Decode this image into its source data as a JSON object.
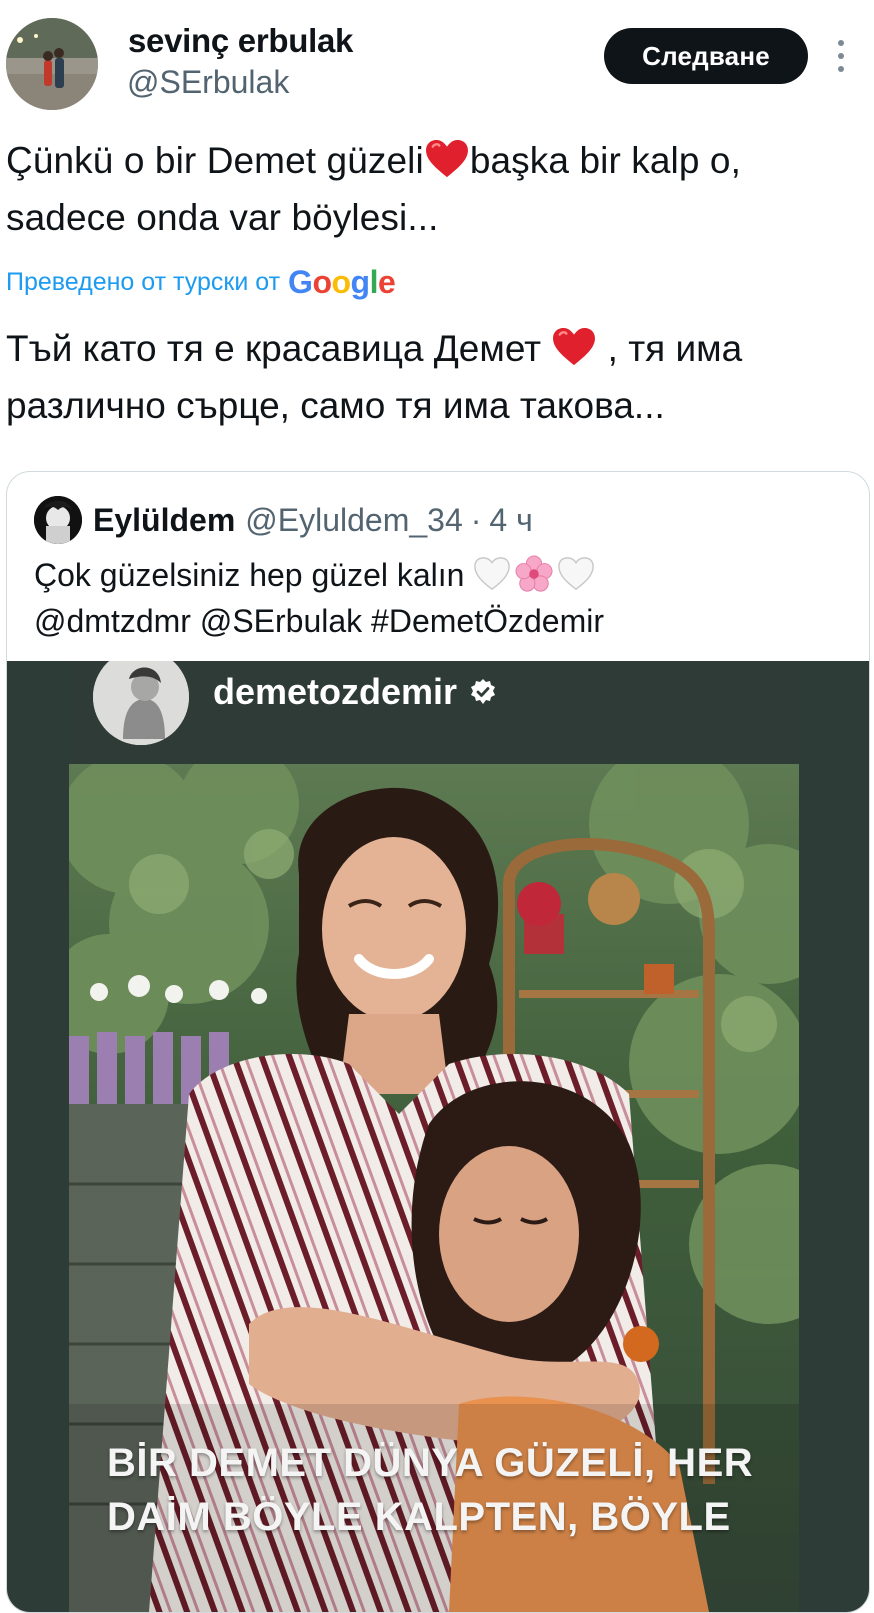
{
  "author": {
    "name": "sevinç erbulak",
    "handle": "@SErbulak",
    "avatar_icon": "avatar-photo"
  },
  "actions": {
    "follow_label": "Следване",
    "more_icon": "more-vertical-icon"
  },
  "tweet": {
    "line1_a": "Çünkü o bir Demet güzeli",
    "line1_b": "başka bir kalp o,",
    "line2": "sadece onda var böylesi...",
    "heart_icon": "red-heart-emoji",
    "heart_color": "#e0202c"
  },
  "translation": {
    "label": "Преведено от турски от",
    "provider": "Google",
    "line1_a": "Тъй като тя е красавица Демет",
    "line1_b": ", тя има",
    "line2": "различно сърце, само тя има такова..."
  },
  "quote": {
    "name": "Eylüldem",
    "handle": "@Eyluldem_34",
    "separator": "·",
    "time": "4 ч",
    "text_a": "Çok güzelsiniz hep güzel kalın",
    "text_b": "@dmtzdmr @SErbulak #DemetÖzdemir",
    "emojis": [
      "white-heart-emoji",
      "cherry-blossom-emoji",
      "white-heart-emoji"
    ]
  },
  "story": {
    "username": "demetozdemir",
    "verified_icon": "verified-badge-icon",
    "caption_line1": "BİR DEMET DÜNYA GÜZELİ, HER",
    "caption_line2": "DAİM BÖYLE KALPTEN, BÖYLE"
  },
  "colors": {
    "link": "#1d9bf0",
    "secondary_text": "#536471",
    "primary_text": "#0f1419",
    "button_bg": "#0f1419",
    "story_bg": "#2d3c37"
  }
}
